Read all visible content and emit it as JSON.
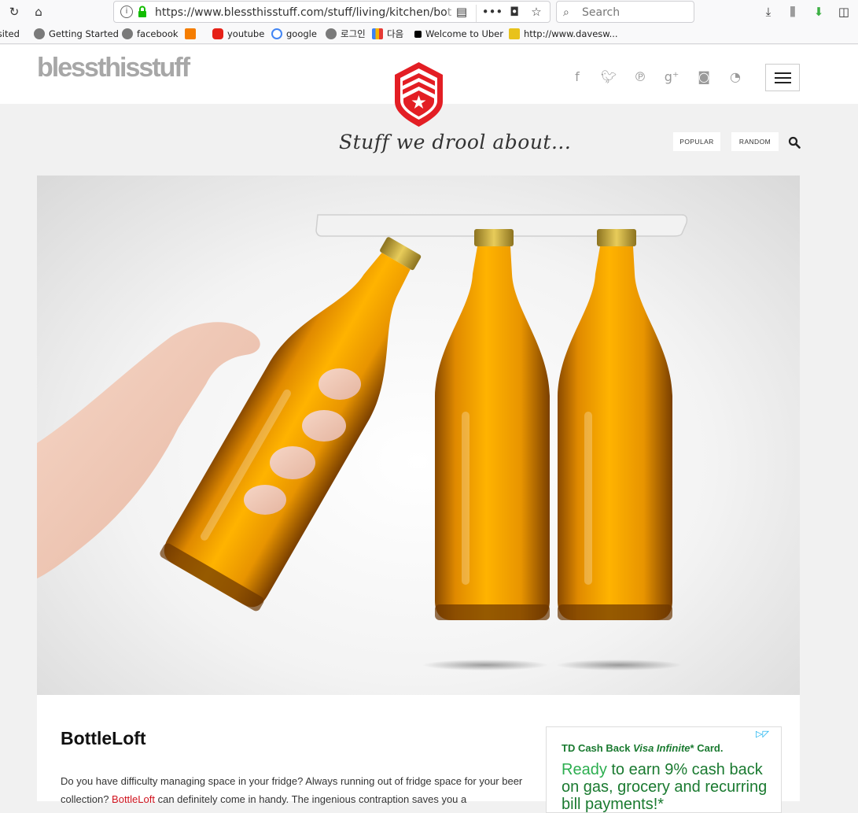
{
  "browser": {
    "url_main": "https://www.blessthisstuff.com/stuff/living/kitchen/bo",
    "url_faded": "t",
    "search_placeholder": "Search",
    "bookmarks": [
      {
        "label": "Visited",
        "color": "#888888"
      },
      {
        "label": "Getting Started",
        "color": "#7a7a7a"
      },
      {
        "label": "facebook",
        "color": "#7a7a7a"
      },
      {
        "label": "",
        "color": "#f57d00"
      },
      {
        "label": "youtube",
        "color": "#e62117"
      },
      {
        "label": "google",
        "color": "#4285f4"
      },
      {
        "label": "로그인",
        "color": "#7a7a7a"
      },
      {
        "label": "다음",
        "color": "#3b82f6"
      },
      {
        "label": "Welcome to Uber",
        "color": "#000000"
      },
      {
        "label": "http://www.davesw...",
        "color": "#e8c21b"
      }
    ]
  },
  "site": {
    "logo": "blessthisstuff",
    "tagline": "Stuff we drool about...",
    "nav": {
      "popular": "POPULAR",
      "random": "RANDOM"
    },
    "brand_color": "#e31e24",
    "social_icons": [
      "facebook-icon",
      "twitter-icon",
      "pinterest-icon",
      "google-plus-icon",
      "instagram-icon",
      "rss-icon"
    ]
  },
  "post": {
    "title": "BottleLoft",
    "body_start": "Do you have difficulty managing space in your fridge? Always running out of fridge space for your beer collection? ",
    "link_text": "BottleLoft",
    "body_end": " can definitely come in handy. The ingenious contraption saves you a"
  },
  "ad": {
    "brand": "TD Cash Back ",
    "brand_italic": "Visa Infinite",
    "brand_end": "* Card.",
    "highlight": "Ready",
    "copy_rest": " to earn 9% cash back on gas, grocery and recurring bill payments!*"
  }
}
